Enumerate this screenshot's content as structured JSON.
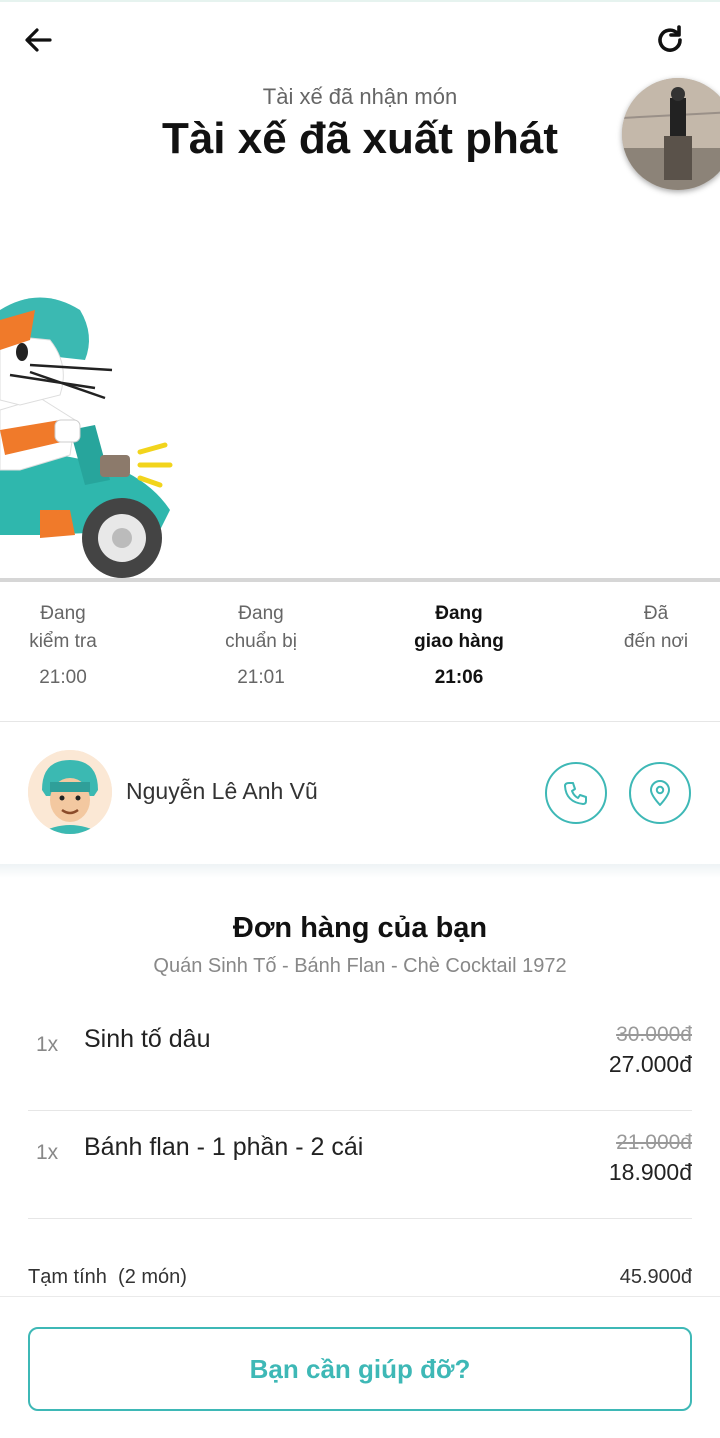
{
  "header": {
    "back_icon": "arrow-left-icon",
    "refresh_icon": "refresh-icon",
    "status_subtitle": "Tài xế đã nhận món",
    "status_title": "Tài xế đã xuất phát"
  },
  "progress": {
    "steps": [
      {
        "line1": "Đang",
        "line2": "kiểm tra",
        "time": "21:00",
        "active": false
      },
      {
        "line1": "Đang",
        "line2": "chuẩn bị",
        "time": "21:01",
        "active": false
      },
      {
        "line1": "Đang",
        "line2": "giao hàng",
        "time": "21:06",
        "active": true
      },
      {
        "line1": "Đã",
        "line2": "đến nơi",
        "time": "",
        "active": false
      }
    ]
  },
  "driver": {
    "name": "Nguyễn Lê Anh Vũ",
    "call_icon": "phone-icon",
    "map_icon": "location-pin-icon"
  },
  "order": {
    "title": "Đơn hàng của bạn",
    "restaurant": "Quán Sinh Tố - Bánh Flan - Chè Cocktail 1972",
    "items": [
      {
        "qty": "1x",
        "name": "Sinh tố dâu",
        "old_price": "30.000đ",
        "price": "27.000đ"
      },
      {
        "qty": "1x",
        "name": "Bánh flan - 1 phần - 2 cái",
        "old_price": "21.000đ",
        "price": "18.900đ"
      }
    ],
    "subtotal_label": "Tạm tính  (2 món)",
    "subtotal_value": "45.900đ"
  },
  "footer": {
    "help_label": "Bạn cần giúp đỡ?"
  },
  "colors": {
    "accent": "#3eb8b6",
    "scooter": "#2fb7ad",
    "text_primary": "#111111",
    "text_secondary": "#666666"
  }
}
